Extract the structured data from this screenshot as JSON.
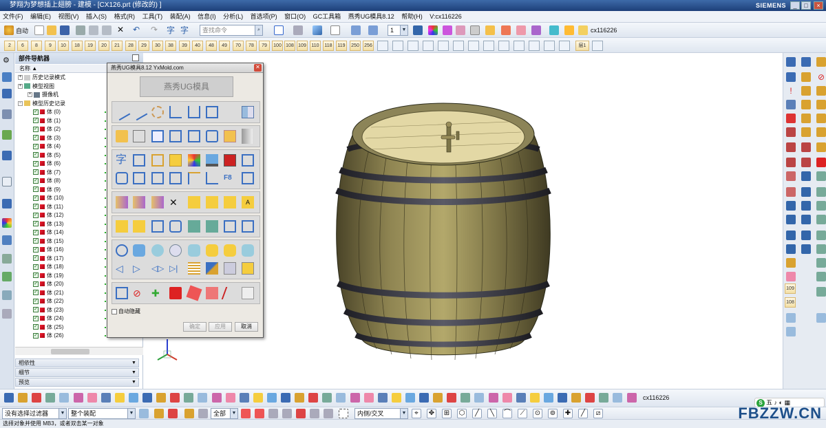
{
  "window": {
    "title": "梦翔为梦想插上翅膀 - 建模 - [CX126.prt  (修改的)  ]",
    "brand": "SIEMENS"
  },
  "menubar": {
    "items": [
      "文件(F)",
      "编辑(E)",
      "视图(V)",
      "插入(S)",
      "格式(R)",
      "工具(T)",
      "装配(A)",
      "信息(I)",
      "分析(L)",
      "首选项(P)",
      "窗口(O)",
      "GC工具箱",
      "燕秀UG模具8.12",
      "帮助(H)",
      "V:cx116226"
    ]
  },
  "toolbar1": {
    "start_label": "自动",
    "font_label_1": "字",
    "font_label_2": "字",
    "search_placeholder": "查找命令",
    "layer_value": "1",
    "user_label": "cx116226"
  },
  "toolbar2": {
    "numbers": [
      "2",
      "6",
      "8",
      "9",
      "10",
      "18",
      "19",
      "20",
      "21",
      "28",
      "29",
      "30",
      "38",
      "39",
      "40",
      "48",
      "49",
      "70",
      "78",
      "79",
      "100",
      "108",
      "109",
      "110",
      "118",
      "119",
      "250",
      "256"
    ],
    "layer_label": "层1"
  },
  "navigator": {
    "title": "部件导航器",
    "column": "名称",
    "top_rows": [
      "历史记录模式",
      "模型视图",
      "摄像机",
      "模型历史记录"
    ],
    "bodies": [
      "体 (0)",
      "体 (1)",
      "体 (2)",
      "体 (3)",
      "体 (4)",
      "体 (5)",
      "体 (6)",
      "体 (7)",
      "体 (8)",
      "体 (9)",
      "体 (10)",
      "体 (11)",
      "体 (12)",
      "体 (13)",
      "体 (14)",
      "体 (15)",
      "体 (16)",
      "体 (17)",
      "体 (18)",
      "体 (19)",
      "体 (20)",
      "体 (21)",
      "体 (22)",
      "体 (23)",
      "体 (24)",
      "体 (25)",
      "体 (26)"
    ],
    "panels": [
      "相依性",
      "细节",
      "预览"
    ]
  },
  "dialog": {
    "title": "燕秀UG模具8.12   YxMold.com",
    "banner": "燕秀UG模具",
    "auto_hide": "自动隐藏",
    "ok": "确定",
    "apply": "应用",
    "cancel": "取消"
  },
  "bottom": {
    "filter_value": "没有选择过滤器",
    "assembly_value": "整个装配",
    "all_value": "全部",
    "intersect_value": "内侧/交叉",
    "user_label": "cx116226",
    "ime_text": "五",
    "status_text": "选择对象并使用 MB3，或者双击某一对象"
  },
  "watermark": "FBZZW.CN"
}
